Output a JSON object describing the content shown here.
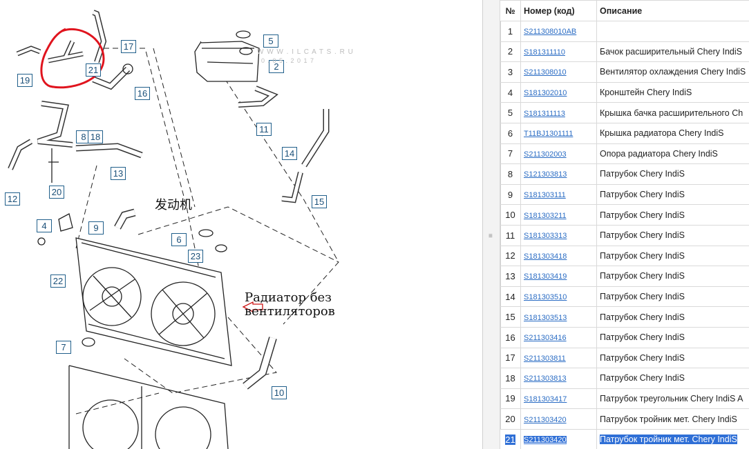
{
  "diagram": {
    "callouts": [
      "17",
      "5",
      "19",
      "21",
      "2",
      "16",
      "11",
      "8",
      "18",
      "14",
      "13",
      "12",
      "20",
      "15",
      "4",
      "9",
      "6",
      "23",
      "22",
      "7",
      "10"
    ],
    "watermark_line1": "W W W . I L C A T S . R U",
    "watermark_line2": "0 . 0 5 . 2 0 1 7",
    "engine_caption": "发动机",
    "radiator_caption_line1": "Радиатор без",
    "radiator_caption_line2": "вентиляторов"
  },
  "table": {
    "headers": [
      "№",
      "Номер (код)",
      "Описание"
    ],
    "rows": [
      {
        "num": "1",
        "code": "S211308010AB",
        "desc": ""
      },
      {
        "num": "2",
        "code": "S181311110",
        "desc": "Бачок расширительный Chery IndiS"
      },
      {
        "num": "3",
        "code": "S211308010",
        "desc": "Вентилятор охлаждения Chery IndiS"
      },
      {
        "num": "4",
        "code": "S181302010",
        "desc": "Кронштейн Chery IndiS"
      },
      {
        "num": "5",
        "code": "S181311113",
        "desc": "Крышка бачка расширительного Ch"
      },
      {
        "num": "6",
        "code": "T11BJ1301111",
        "desc": "Крышка радиатора Chery IndiS"
      },
      {
        "num": "7",
        "code": "S211302003",
        "desc": "Опора радиатора Chery IndiS"
      },
      {
        "num": "8",
        "code": "S121303813",
        "desc": "Патрубок Chery IndiS"
      },
      {
        "num": "9",
        "code": "S181303111",
        "desc": "Патрубок Chery IndiS"
      },
      {
        "num": "10",
        "code": "S181303211",
        "desc": "Патрубок Chery IndiS"
      },
      {
        "num": "11",
        "code": "S181303313",
        "desc": "Патрубок Chery IndiS"
      },
      {
        "num": "12",
        "code": "S181303418",
        "desc": "Патрубок Chery IndiS"
      },
      {
        "num": "13",
        "code": "S181303419",
        "desc": "Патрубок Chery IndiS"
      },
      {
        "num": "14",
        "code": "S181303510",
        "desc": "Патрубок Chery IndiS"
      },
      {
        "num": "15",
        "code": "S181303513",
        "desc": "Патрубок Chery IndiS"
      },
      {
        "num": "16",
        "code": "S211303416",
        "desc": "Патрубок Chery IndiS"
      },
      {
        "num": "17",
        "code": "S211303811",
        "desc": "Патрубок Chery IndiS"
      },
      {
        "num": "18",
        "code": "S211303813",
        "desc": "Патрубок Chery IndiS"
      },
      {
        "num": "19",
        "code": "S181303417",
        "desc": "Патрубок треугольник Chery IndiS A"
      },
      {
        "num": "20",
        "code": "S211303420",
        "desc": "Патрубок тройник мет. Chery IndiS"
      },
      {
        "num": "21",
        "code": "S211303420",
        "desc": "Патрубок тройник мет. Chery IndiS"
      }
    ],
    "selected_row": "21"
  },
  "colors": {
    "link": "#2a6cc4",
    "highlight": "#2f6fd6",
    "callout_border": "#1f5e8a",
    "annotation_red": "#e0141e"
  }
}
